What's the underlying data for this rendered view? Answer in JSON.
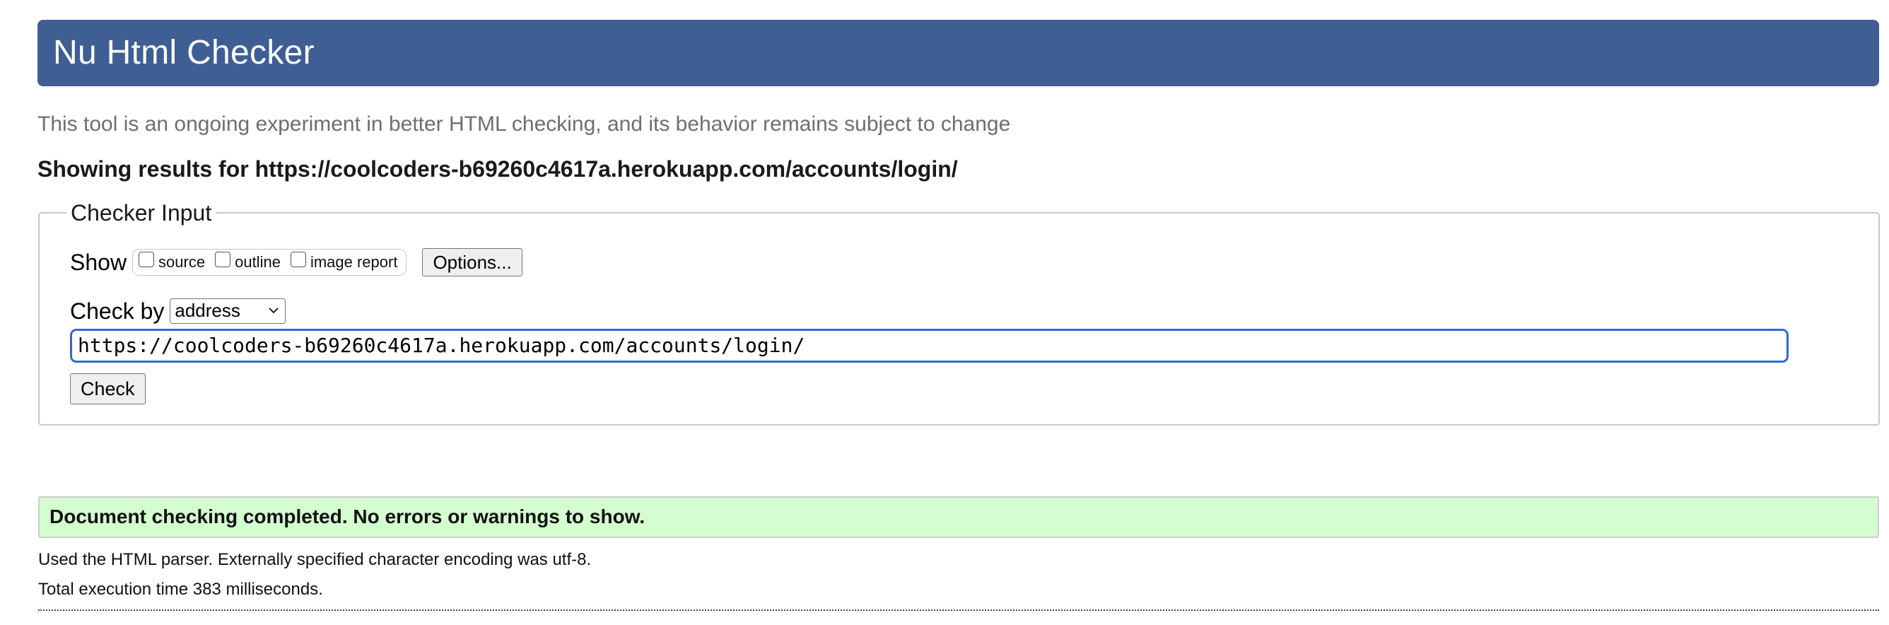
{
  "header": {
    "title": "Nu Html Checker"
  },
  "tagline": "This tool is an ongoing experiment in better HTML checking, and its behavior remains subject to change",
  "results_heading": "Showing results for https://coolcoders-b69260c4617a.herokuapp.com/accounts/login/",
  "checker_input": {
    "legend": "Checker Input",
    "show": {
      "label": "Show",
      "options": [
        {
          "label": "source",
          "checked": false
        },
        {
          "label": "outline",
          "checked": false
        },
        {
          "label": "image report",
          "checked": false
        }
      ],
      "options_button_label": "Options..."
    },
    "check_by": {
      "label": "Check by",
      "selected": "address"
    },
    "url_value": "https://coolcoders-b69260c4617a.herokuapp.com/accounts/login/",
    "check_button_label": "Check"
  },
  "result": {
    "message": "Document checking completed. No errors or warnings to show.",
    "parser_info": "Used the HTML parser. Externally specified character encoding was utf-8.",
    "execution_time": "Total execution time 383 milliseconds."
  },
  "colors": {
    "header_bg": "#3e5e94",
    "success_bg": "#d4fdd0",
    "input_focus": "#2c6bd0"
  },
  "icons": {
    "select_arrow": "chevron-down-icon"
  }
}
